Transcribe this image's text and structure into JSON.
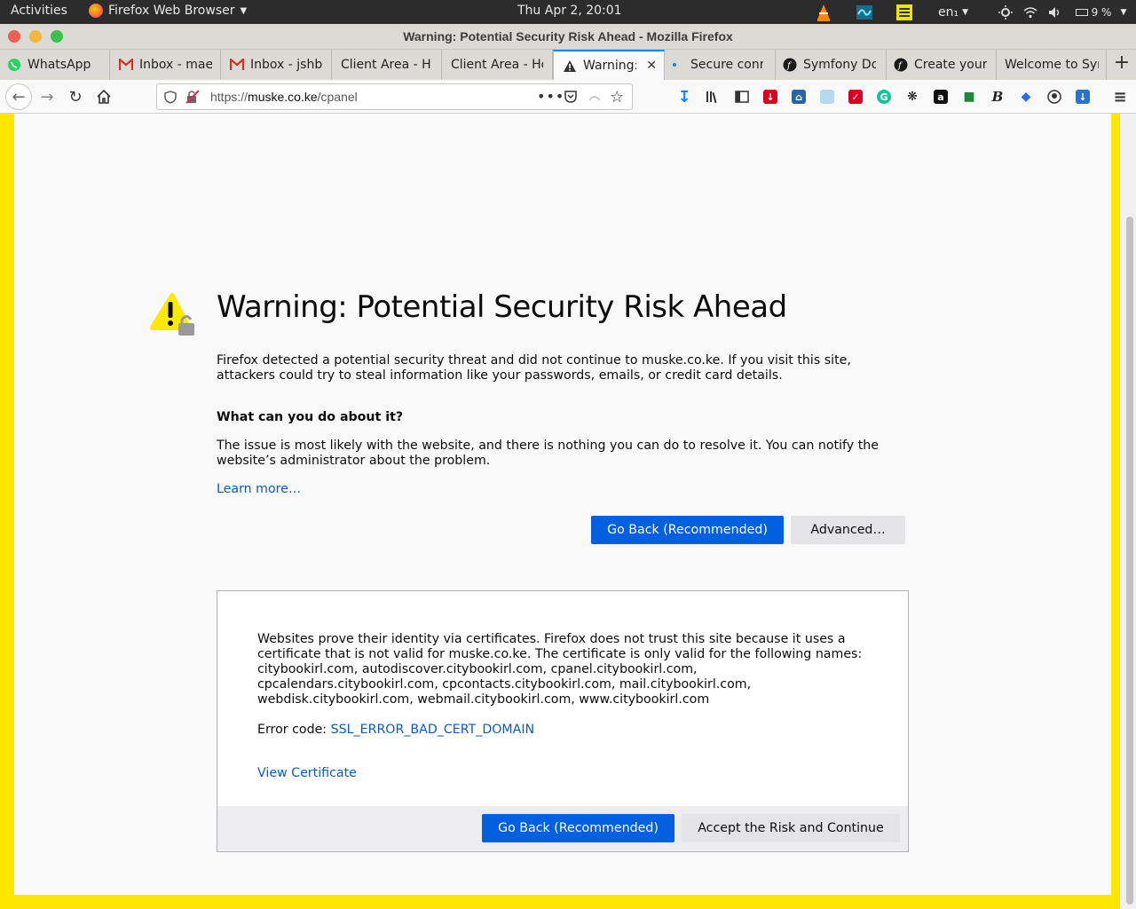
{
  "topbar": {
    "activities": "Activities",
    "app_name": "Firefox Web Browser",
    "clock": "Thu Apr  2, 20:01",
    "language": "en₁",
    "battery": "9 %"
  },
  "window": {
    "title": "Warning: Potential Security Risk Ahead - Mozilla Firefox"
  },
  "tabs": [
    {
      "label": "WhatsApp"
    },
    {
      "label": "Inbox - maes"
    },
    {
      "label": "Inbox - jshbr"
    },
    {
      "label": "Client Area - Ho"
    },
    {
      "label": "Client Area - Ho"
    },
    {
      "label": "Warning: Potential Security Risk Ahead"
    },
    {
      "label": "Secure conn"
    },
    {
      "label": "Symfony Do"
    },
    {
      "label": "Create your"
    },
    {
      "label": "Welcome to Sym"
    }
  ],
  "urlbar": {
    "scheme": "https://",
    "host": "muske.co.ke",
    "path": "/cpanel"
  },
  "page": {
    "title": "Warning: Potential Security Risk Ahead",
    "intro": "Firefox detected a potential security threat and did not continue to muske.co.ke. If you visit this site, attackers could try to steal information like your passwords, emails, or credit card details.",
    "what_heading": "What can you do about it?",
    "what_text": "The issue is most likely with the website, and there is nothing you can do to resolve it. You can notify the website’s administrator about the problem.",
    "learn_more": "Learn more…",
    "go_back": "Go Back (Recommended)",
    "advanced": "Advanced…",
    "advanced_panel": {
      "text": "Websites prove their identity via certificates. Firefox does not trust this site because it uses a certificate that is not valid for muske.co.ke. The certificate is only valid for the following names: citybookirl.com, autodiscover.citybookirl.com, cpanel.citybookirl.com, cpcalendars.citybookirl.com, cpcontacts.citybookirl.com, mail.citybookirl.com, webdisk.citybookirl.com, webmail.citybookirl.com, www.citybookirl.com",
      "error_label": "Error code: ",
      "error_code": "SSL_ERROR_BAD_CERT_DOMAIN",
      "view_certificate": "View Certificate",
      "go_back": "Go Back (Recommended)",
      "accept": "Accept the Risk and Continue"
    }
  },
  "colors": {
    "page_border": "#ffe600",
    "primary_button": "#0060df",
    "link": "#0a5cbb",
    "active_tab_accent": "#0a84ff"
  }
}
